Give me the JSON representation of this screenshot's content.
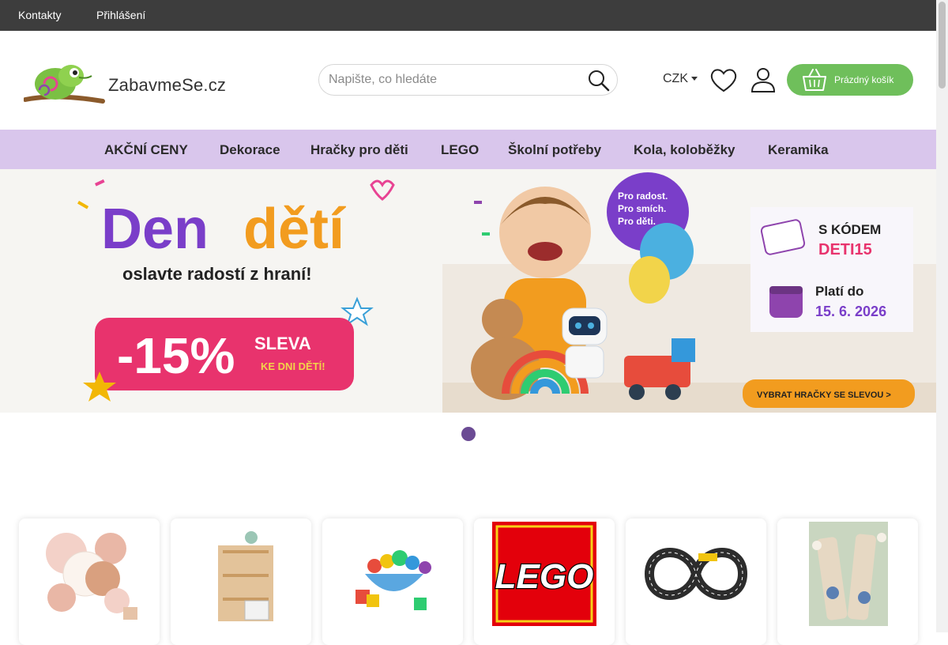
{
  "topbar": {
    "links": [
      "Kontakty",
      "Přihlášení"
    ]
  },
  "header": {
    "logo_text": "ZabavmeSe.cz",
    "search_placeholder": "Napište, co hledáte",
    "currency": "CZK",
    "cart_label": "Prázdný košík"
  },
  "nav": [
    "AKČNÍ CENY",
    "Dekorace",
    "Hračky pro děti",
    "LEGO",
    "Školní potřeby",
    "Kola, koloběžky",
    "Keramika"
  ],
  "banner": {
    "title_part1": "Den",
    "title_part2": "dětí",
    "subtitle": "oslavte radostí z hraní!",
    "discount": "-15%",
    "sleva": "SLEVA",
    "sleva_sub": "KE DNI DĚTÍ!",
    "balloon_text": [
      "Pro radost.",
      "Pro smích.",
      "Pro děti."
    ],
    "code_label": "S KÓDEM",
    "code": "DETI15",
    "valid_label": "Platí do",
    "valid_date": "15. 6. 2026",
    "cta": "VYBRAT HRAČKY SE SLEVOU >"
  },
  "tiles": {
    "lego_logo": "LEGO"
  },
  "colors": {
    "topbar": "#3d3d3d",
    "nav": "#d9c6ec",
    "cart": "#6fbf5b",
    "accent_purple": "#6b4b94"
  }
}
